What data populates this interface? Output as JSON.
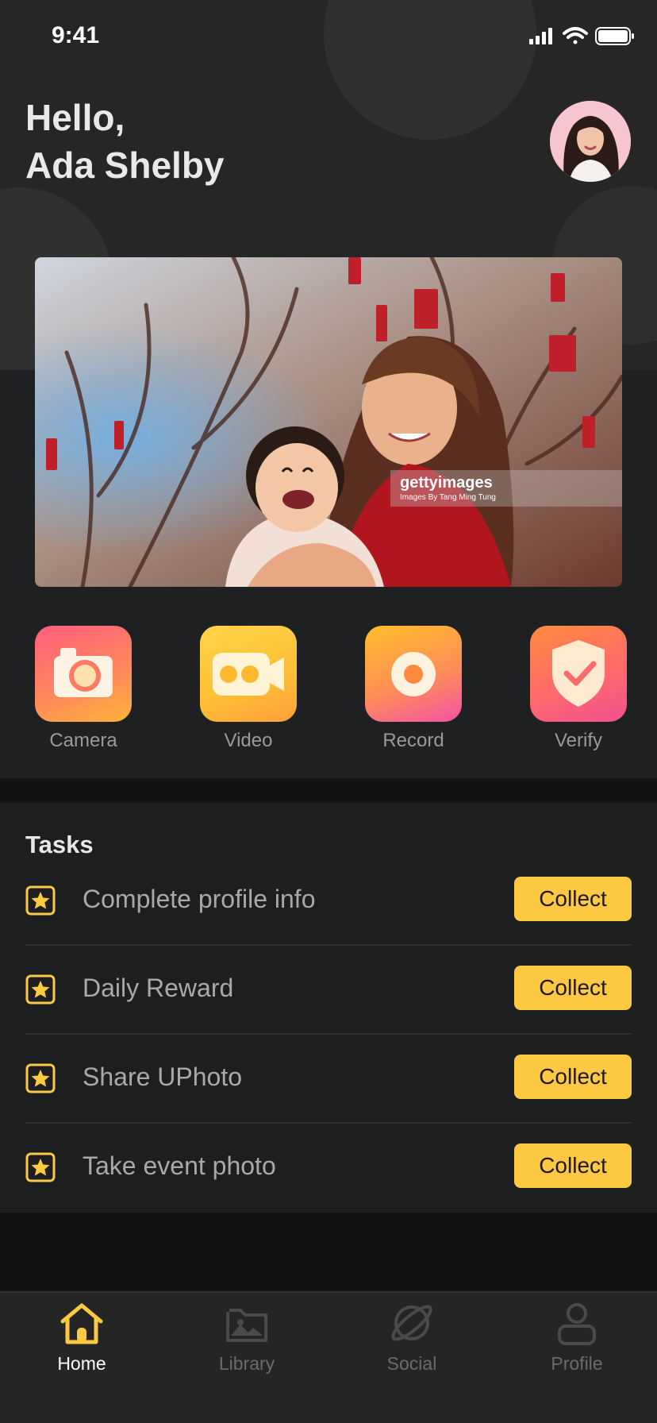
{
  "status_bar": {
    "time": "9:41"
  },
  "greeting": {
    "line1": "Hello,",
    "line2": "Ada Shelby"
  },
  "hero": {
    "watermark_brand": "gettyimages",
    "watermark_credit": "Images By Tang Ming Tung"
  },
  "actions": [
    {
      "label": "Camera",
      "icon": "camera-icon"
    },
    {
      "label": "Video",
      "icon": "video-icon"
    },
    {
      "label": "Record",
      "icon": "record-icon"
    },
    {
      "label": "Verify",
      "icon": "shield-check-icon"
    }
  ],
  "tasks": {
    "title": "Tasks",
    "items": [
      {
        "label": "Complete profile info",
        "button": "Collect"
      },
      {
        "label": "Daily Reward",
        "button": "Collect"
      },
      {
        "label": "Share UPhoto",
        "button": "Collect"
      },
      {
        "label": "Take event photo",
        "button": "Collect"
      }
    ]
  },
  "nav": {
    "items": [
      {
        "label": "Home",
        "icon": "home-icon",
        "active": true
      },
      {
        "label": "Library",
        "icon": "library-icon",
        "active": false
      },
      {
        "label": "Social",
        "icon": "planet-icon",
        "active": false
      },
      {
        "label": "Profile",
        "icon": "profile-icon",
        "active": false
      }
    ]
  },
  "colors": {
    "accent": "#FDC842",
    "background": "#121314",
    "header": "#262626",
    "panel": "#1F2022",
    "muted_text": "#9A9A9A"
  }
}
